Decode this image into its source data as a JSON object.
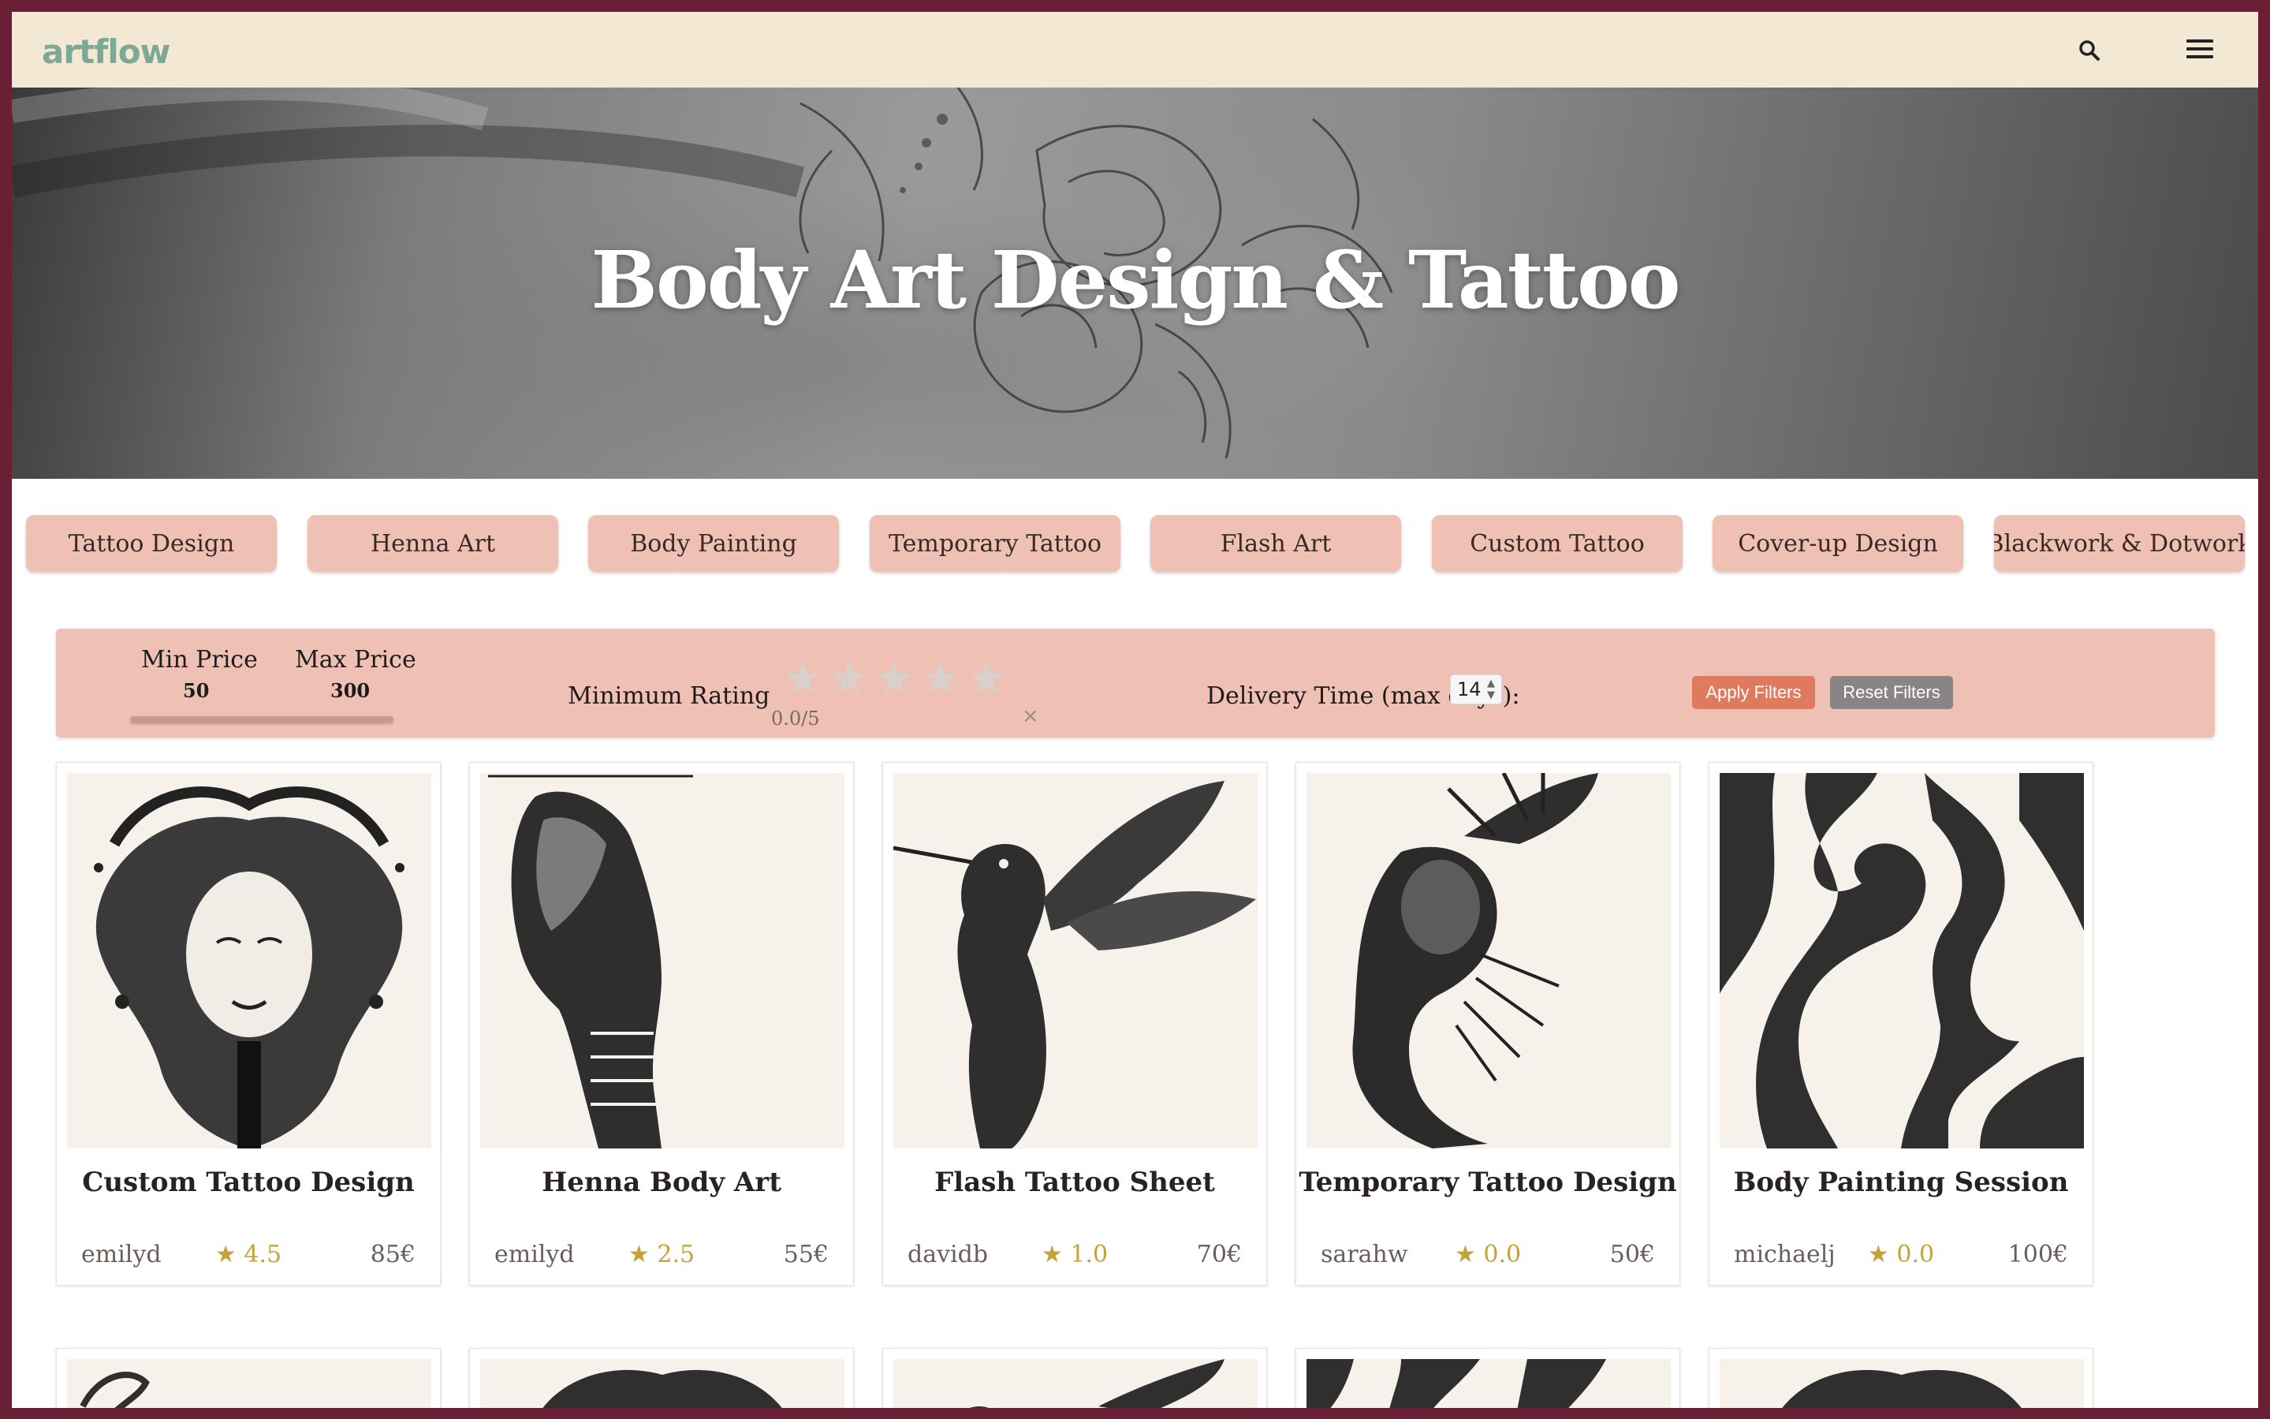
{
  "header": {
    "logo": "artflow",
    "search_icon": "search-icon",
    "menu_icon": "hamburger-menu-icon"
  },
  "hero": {
    "title": "Body Art Design & Tattoo"
  },
  "categories": [
    "Tattoo Design",
    "Henna Art",
    "Body Painting",
    "Temporary Tattoo",
    "Flash Art",
    "Custom Tattoo",
    "Cover-up Design",
    "Blackwork & Dotwork"
  ],
  "filters": {
    "min_price_label": "Min Price",
    "min_price": "50",
    "max_price_label": "Max Price",
    "max_price": "300",
    "rating_label": "Minimum Rating",
    "rating_value": "0.0/5",
    "rating_stars": 0,
    "clear": "×",
    "delivery_label": "Delivery Time (max days):",
    "delivery_value": "14",
    "apply": "Apply Filters",
    "reset": "Reset Filters"
  },
  "listings": [
    {
      "title": "Custom Tattoo Design",
      "seller": "emilyd",
      "rating": "★ 4.5",
      "price": "85€"
    },
    {
      "title": "Henna Body Art",
      "seller": "emilyd",
      "rating": "★ 2.5",
      "price": "55€"
    },
    {
      "title": "Flash Tattoo Sheet",
      "seller": "davidb",
      "rating": "★ 1.0",
      "price": "70€"
    },
    {
      "title": "Temporary Tattoo Design",
      "seller": "sarahw",
      "rating": "★ 0.0",
      "price": "50€"
    },
    {
      "title": "Body Painting Session",
      "seller": "michaelj",
      "rating": "★ 0.0",
      "price": "100€"
    }
  ],
  "colors": {
    "frame": "#6b1f35",
    "topbar": "#f3e8d3",
    "logo": "#7ea896",
    "pill": "#efc0b4",
    "apply": "#e07a5f",
    "reset": "#8a8585",
    "star": "#c6a23a"
  }
}
